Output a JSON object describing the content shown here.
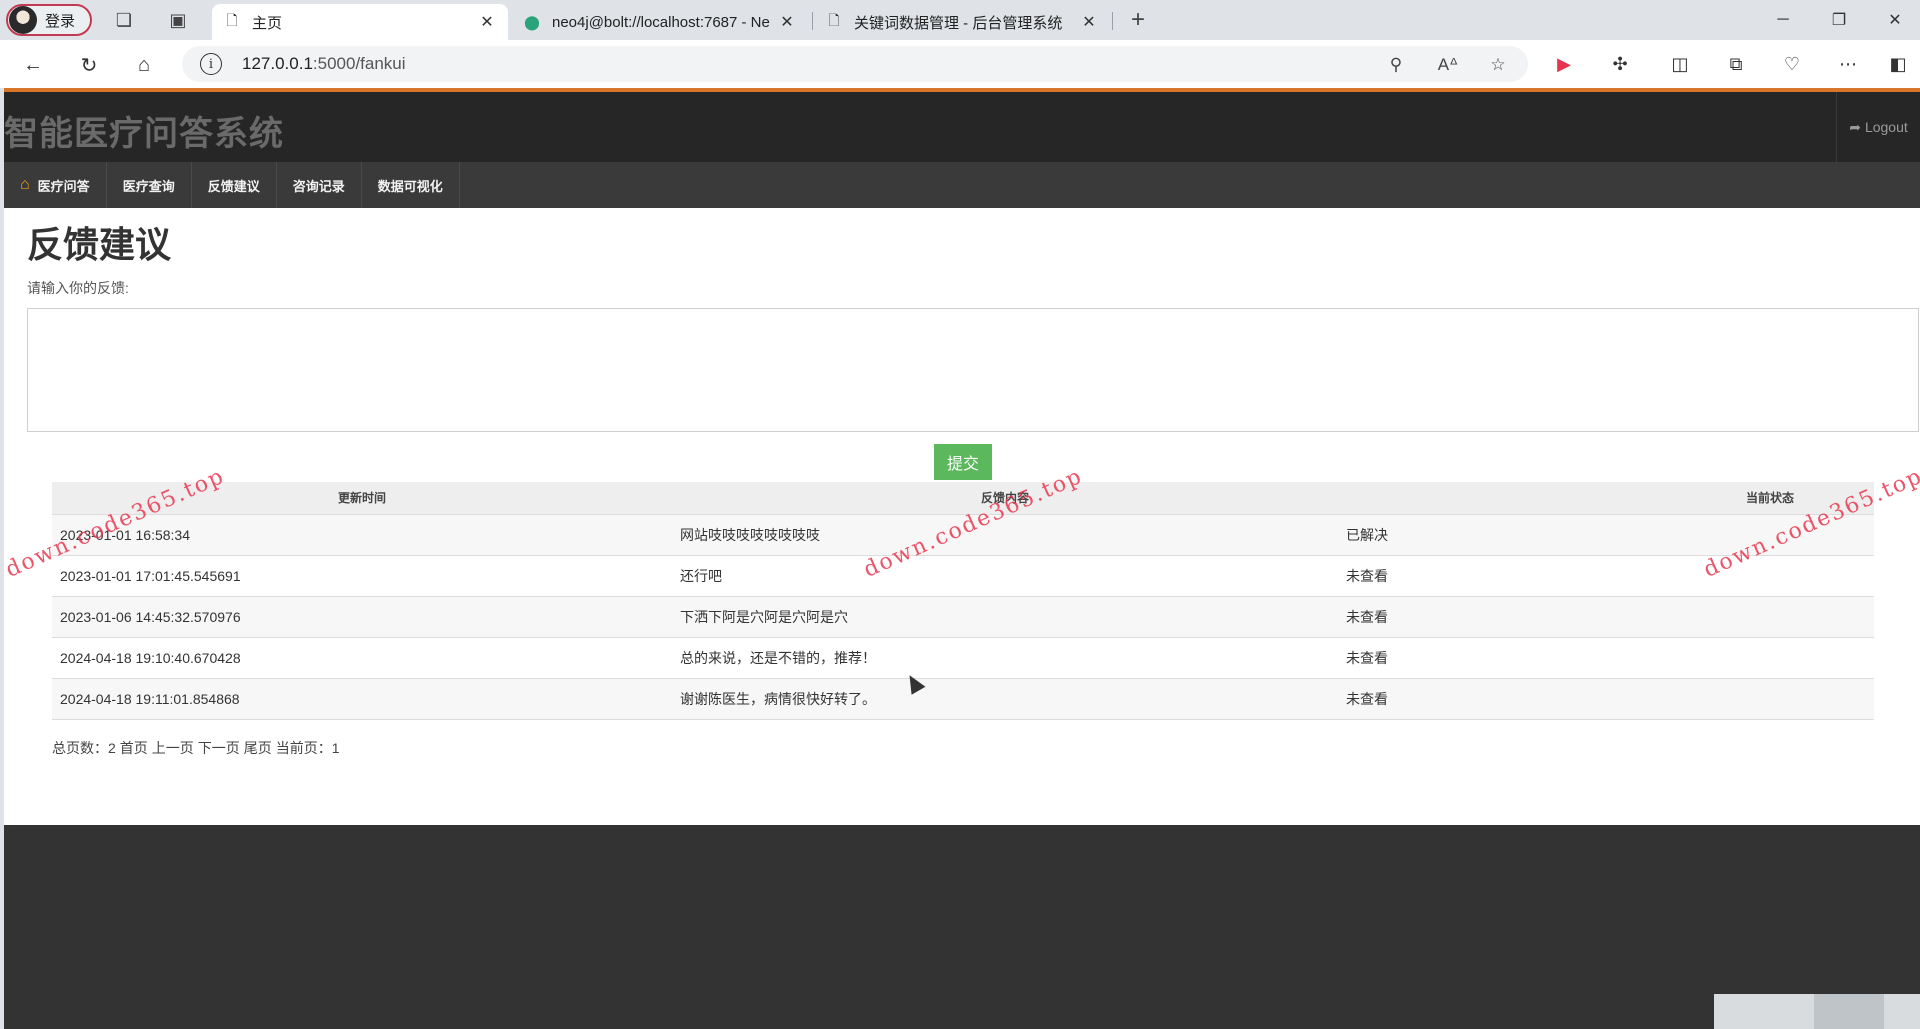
{
  "browser": {
    "profile_label": "登录",
    "tabs": [
      {
        "title": "主页",
        "active": true,
        "icon": "page-icon"
      },
      {
        "title": "neo4j@bolt://localhost:7687 - Ne",
        "active": false,
        "icon": "neo4j-icon"
      },
      {
        "title": "关键词数据管理 - 后台管理系统",
        "active": false,
        "icon": "page-icon"
      }
    ],
    "url_host": "127.0.0.1",
    "url_path": ":5000/fankui"
  },
  "site": {
    "title": "智能医疗问答系统",
    "logout_label": "Logout",
    "nav": [
      "医疗问答",
      "医疗查询",
      "反馈建议",
      "咨询记录",
      "数据可视化"
    ]
  },
  "feedback": {
    "page_title": "反馈建议",
    "input_label": "请输入你的反馈:",
    "textarea_value": "",
    "submit_label": "提交"
  },
  "table": {
    "headers": [
      "更新时间",
      "反馈内容",
      "当前状态"
    ],
    "rows": [
      [
        "2023-01-01 16:58:34",
        "网站吱吱吱吱吱吱吱吱",
        "已解决"
      ],
      [
        "2023-01-01 17:01:45.545691",
        "还行吧",
        "未查看"
      ],
      [
        "2023-01-06 14:45:32.570976",
        "下洒下阿是穴阿是穴阿是穴",
        "未查看"
      ],
      [
        "2024-04-18 19:10:40.670428",
        "总的来说，还是不错的，推荐！",
        "未查看"
      ],
      [
        "2024-04-18 19:11:01.854868",
        "谢谢陈医生，病情很快好转了。",
        "未查看"
      ]
    ]
  },
  "pager": {
    "total_label": "总页数：2",
    "first": "首页",
    "prev": "上一页",
    "next": "下一页",
    "last": "尾页",
    "current_label": "当前页：1"
  },
  "watermark_text": "down.code365.top",
  "colors": {
    "header_bg": "#262626",
    "nav_bg": "#3a3a3a",
    "accent_orange": "#d9762a",
    "submit_green": "#5cb85c",
    "footer_bg": "#333333",
    "watermark": "#e8384f"
  }
}
